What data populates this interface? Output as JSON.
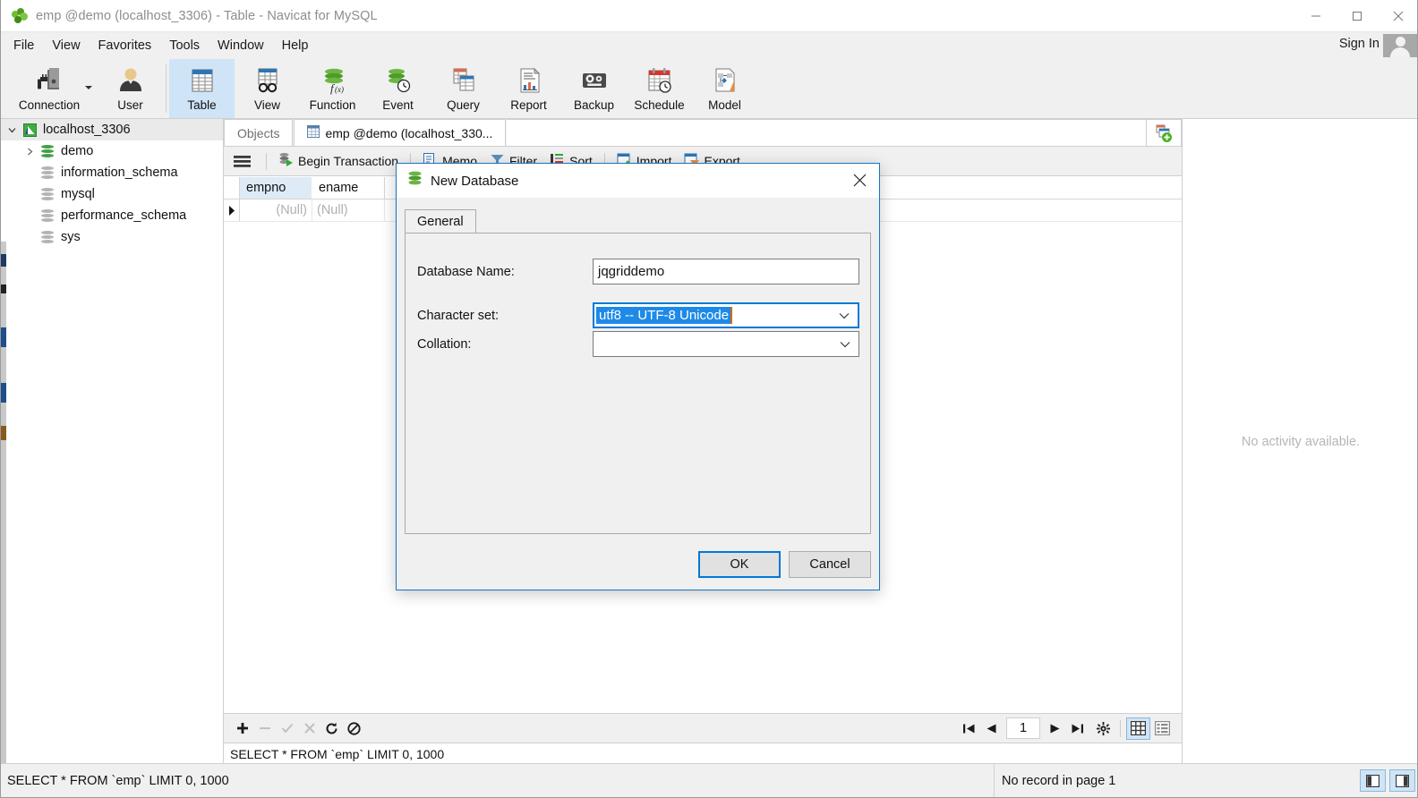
{
  "window": {
    "title": "emp @demo (localhost_3306) - Table - Navicat for MySQL",
    "app_icon": "navicat-leaf-icon",
    "minimize_label": "Minimize",
    "maximize_label": "Maximize",
    "close_label": "Close"
  },
  "menubar": {
    "items": [
      {
        "label": "File"
      },
      {
        "label": "View"
      },
      {
        "label": "Favorites"
      },
      {
        "label": "Tools"
      },
      {
        "label": "Window"
      },
      {
        "label": "Help"
      }
    ],
    "signin_label": "Sign In",
    "avatar_name": "user-avatar"
  },
  "ribbon": {
    "items": [
      {
        "label": "Connection",
        "icon": "connection-icon",
        "selected": false,
        "has_dropdown": true
      },
      {
        "label": "User",
        "icon": "user-icon",
        "selected": false,
        "has_dropdown": false
      },
      {
        "label": "Table",
        "icon": "table-icon",
        "selected": true,
        "has_dropdown": false
      },
      {
        "label": "View",
        "icon": "view-glasses-icon",
        "selected": false,
        "has_dropdown": false
      },
      {
        "label": "Function",
        "icon": "function-icon",
        "selected": false,
        "has_dropdown": false
      },
      {
        "label": "Event",
        "icon": "event-clock-icon",
        "selected": false,
        "has_dropdown": false
      },
      {
        "label": "Query",
        "icon": "query-icon",
        "selected": false,
        "has_dropdown": false
      },
      {
        "label": "Report",
        "icon": "report-icon",
        "selected": false,
        "has_dropdown": false
      },
      {
        "label": "Backup",
        "icon": "backup-tape-icon",
        "selected": false,
        "has_dropdown": false
      },
      {
        "label": "Schedule",
        "icon": "schedule-calendar-icon",
        "selected": false,
        "has_dropdown": false
      },
      {
        "label": "Model",
        "icon": "model-icon",
        "selected": false,
        "has_dropdown": false
      }
    ]
  },
  "sidebar": {
    "items": [
      {
        "label": "localhost_3306",
        "level": 0,
        "icon": "connection-host-icon",
        "expanded": true,
        "selected": true,
        "has_toggle": true
      },
      {
        "label": "demo",
        "level": 1,
        "icon": "database-green-icon",
        "expanded": false,
        "selected": false,
        "has_toggle": true
      },
      {
        "label": "information_schema",
        "level": 1,
        "icon": "database-grey-icon",
        "expanded": false,
        "selected": false,
        "has_toggle": false
      },
      {
        "label": "mysql",
        "level": 1,
        "icon": "database-grey-icon",
        "expanded": false,
        "selected": false,
        "has_toggle": false
      },
      {
        "label": "performance_schema",
        "level": 1,
        "icon": "database-grey-icon",
        "expanded": false,
        "selected": false,
        "has_toggle": false
      },
      {
        "label": "sys",
        "level": 1,
        "icon": "database-grey-icon",
        "expanded": false,
        "selected": false,
        "has_toggle": false
      }
    ]
  },
  "tabs": {
    "items": [
      {
        "label": "Objects",
        "active": false,
        "icon": null
      },
      {
        "label": "emp @demo (localhost_330...",
        "active": true,
        "icon": "table-tab-icon"
      }
    ],
    "add_tab_icon": "new-object-icon"
  },
  "grid_toolbar": {
    "menu_icon": "hamburger-menu-icon",
    "buttons": [
      {
        "label": "Begin Transaction",
        "icon": "begin-transaction-icon"
      },
      {
        "label": "Memo",
        "icon": "memo-icon"
      },
      {
        "label": "Filter",
        "icon": "filter-icon"
      },
      {
        "label": "Sort",
        "icon": "sort-icon"
      },
      {
        "label": "Import",
        "icon": "import-icon"
      },
      {
        "label": "Export",
        "icon": "export-icon"
      }
    ]
  },
  "grid": {
    "columns": [
      "empno",
      "ename"
    ],
    "rows": [
      {
        "indicator": "current-row-arrow",
        "cells": [
          "(Null)",
          "(Null)"
        ]
      }
    ]
  },
  "grid_footer": {
    "left_buttons": [
      {
        "icon": "add-record-icon",
        "enabled": true
      },
      {
        "icon": "remove-record-icon",
        "enabled": false
      },
      {
        "icon": "apply-change-icon",
        "enabled": false
      },
      {
        "icon": "discard-change-icon",
        "enabled": false
      },
      {
        "icon": "refresh-icon",
        "enabled": true
      },
      {
        "icon": "stop-icon",
        "enabled": true
      }
    ],
    "nav_buttons": [
      {
        "icon": "first-page-icon"
      },
      {
        "icon": "prev-page-icon"
      }
    ],
    "page_value": "1",
    "nav_buttons_right": [
      {
        "icon": "next-page-icon"
      },
      {
        "icon": "last-page-icon"
      },
      {
        "icon": "gear-icon"
      }
    ],
    "view_modes": [
      {
        "icon": "grid-view-icon",
        "selected": true
      },
      {
        "icon": "form-view-icon",
        "selected": false
      }
    ]
  },
  "sql_preview": "SELECT * FROM `emp` LIMIT 0, 1000",
  "activity_panel": {
    "message": "No activity available."
  },
  "statusbar": {
    "sql": "SELECT * FROM `emp` LIMIT 0, 1000",
    "record_info": "No record in page 1",
    "toggles": [
      {
        "icon": "toggle-left-pane-icon",
        "selected": true
      },
      {
        "icon": "toggle-right-pane-icon",
        "selected": true
      }
    ]
  },
  "dialog": {
    "title": "New Database",
    "icon": "database-green-icon",
    "close_label": "Close",
    "tabs": [
      {
        "label": "General",
        "active": true
      }
    ],
    "fields": {
      "database_name": {
        "label": "Database Name:",
        "value": "jqgriddemo",
        "placeholder": ""
      },
      "character_set": {
        "label": "Character set:",
        "value": "utf8 -- UTF-8 Unicode",
        "selected": true,
        "placeholder": ""
      },
      "collation": {
        "label": "Collation:",
        "value": "",
        "placeholder": ""
      }
    },
    "buttons": {
      "ok": "OK",
      "cancel": "Cancel"
    }
  },
  "colors": {
    "accent": "#0078d7",
    "selection": "#1e8ae8",
    "ribbon_selected": "#cfe4f7",
    "grid_header": "#deeaf6",
    "chrome": "#f0f0f0",
    "db_green": "#43a047"
  }
}
